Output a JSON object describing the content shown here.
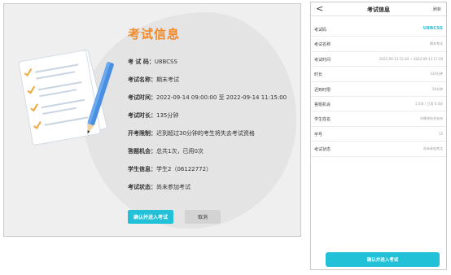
{
  "desktop": {
    "title": "考试信息",
    "rows": [
      {
        "label": "考 试 码：",
        "value": "U8BCSS"
      },
      {
        "label": "考试名称：",
        "value": "期末考试"
      },
      {
        "label": "考试时间：",
        "value": "2022-09-14 09:00:00 至 2022-09-14 11:15:00"
      },
      {
        "label": "考试时长：",
        "value": "135分钟"
      },
      {
        "label": "开考限制：",
        "value": "迟到超过30分钟的考生将失去考试资格"
      },
      {
        "label": "答题机会：",
        "value": "总共1次，已用0次"
      },
      {
        "label": "学生信息：",
        "value": "学生2（06122772）"
      },
      {
        "label": "考试状态：",
        "value": "尚未参加考试"
      }
    ],
    "confirm_label": "确认并进入考试",
    "cancel_label": "取消"
  },
  "mobile": {
    "back": "<",
    "title": "考试信息",
    "refresh": "刷新",
    "rows": [
      {
        "label": "考试码",
        "value": "U8BCSS"
      },
      {
        "label": "考试名称",
        "value": "期末考试"
      },
      {
        "label": "考试时间",
        "value": "2022-09-13 15:30 ~ 2022-09-13 17:30"
      },
      {
        "label": "时长",
        "value": "120分钟"
      },
      {
        "label": "迟到时限",
        "value": "30分钟"
      },
      {
        "label": "答题机会",
        "value": "1.0次 / 已用 0.0次"
      },
      {
        "label": "学生姓名",
        "value": "许辉祥技术支持"
      },
      {
        "label": "学号",
        "value": "12"
      },
      {
        "label": "考试状态",
        "value": "尚未参加考试"
      }
    ],
    "confirm_label": "确认并进入考试"
  },
  "colors": {
    "accent": "#23c1d8",
    "title_orange": "#f08a2b",
    "illustration_blue": "#4a8fe0"
  },
  "icons": [
    "document-illustration-icon",
    "back-arrow-icon"
  ]
}
